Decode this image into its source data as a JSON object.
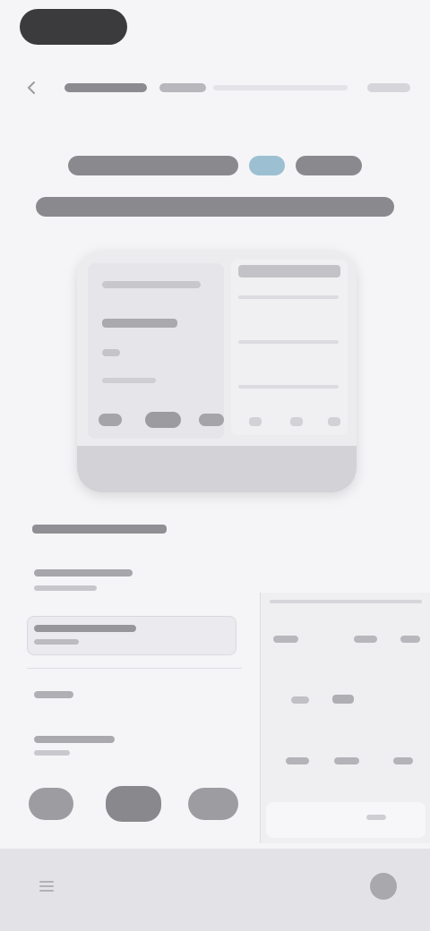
{
  "status_bar": {},
  "nav": {
    "title": "",
    "subtitle": ""
  },
  "headline": {
    "line1_pre": "",
    "line1_accent": "",
    "line1_post": "",
    "line2": ""
  },
  "illustration": {},
  "section": {
    "heading": ""
  },
  "form": {
    "fields": [
      "",
      "",
      "",
      ""
    ]
  },
  "buttons": [
    "",
    "",
    ""
  ],
  "colors": {
    "background": "#f5f5f7",
    "accent": "#7ea7bd",
    "headline": "#4b4b4f",
    "card": "#ececef",
    "bottom_bar": "#e3e3e7"
  },
  "icons": {
    "back": "back-icon",
    "bottom_left": "menu-icon",
    "bottom_right": "user-icon"
  }
}
